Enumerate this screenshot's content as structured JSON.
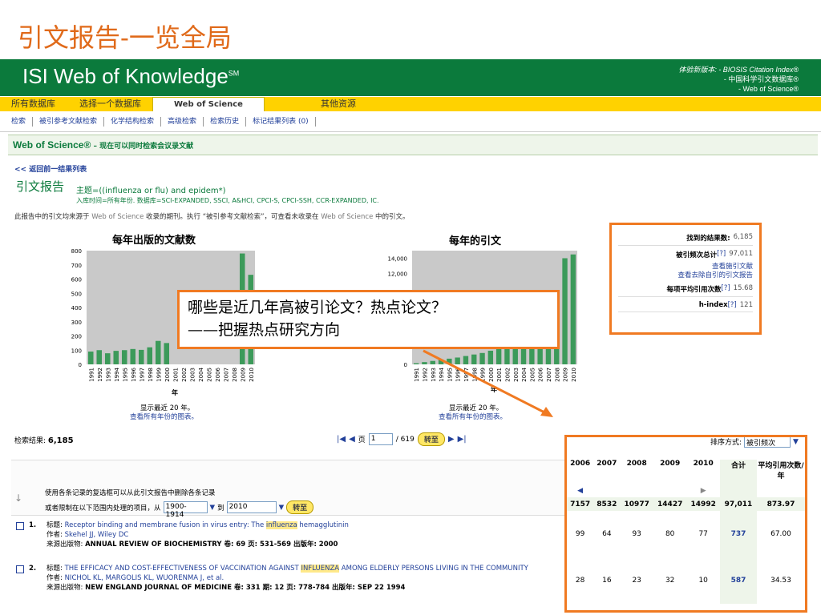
{
  "slide_title": "引文报告-一览全局",
  "banner": {
    "brand": "ISI Web of Knowledge",
    "brand_mark": "SM",
    "editions": [
      "体验新版本: - BIOSIS Citation Index®",
      "- 中国科学引文数据库®",
      "- Web of Science®"
    ]
  },
  "tabs": [
    "所有数据库",
    "选择一个数据库",
    "Web of Science",
    "其他资源"
  ],
  "subnav": [
    "检索",
    "被引参考文献检索",
    "化学结构检索",
    "高级检索",
    "检索历史",
    "标记结果列表 (0)"
  ],
  "wos_header": {
    "title": "Web of Science®",
    "subtitle": "– 现在可以同时检索会议录文献"
  },
  "back_link": "<< 返回前一结果列表",
  "report": {
    "title": "引文报告",
    "query": "主题=((influenza or flu) and epidem*)",
    "meta": "入库时间=所有年份. 数据库=SCI-EXPANDED, SSCI, A&HCI, CPCI-S, CPCI-SSH, CCR-EXPANDED, IC.",
    "note_a": "此报告中的引文均来源于",
    "note_b": "Web of Science",
    "note_c": "收录的期刊。执行 “被引参考文献检索”，可查看未收录在",
    "note_d": "Web of Science",
    "note_e": "中的引文。"
  },
  "chart_data": [
    {
      "type": "bar",
      "title": "每年出版的文献数",
      "xlabel": "年",
      "ylabel": "",
      "ylim": [
        0,
        800
      ],
      "yticks": [
        "800",
        "700",
        "600",
        "500",
        "400",
        "300",
        "200",
        "100",
        "0"
      ],
      "categories": [
        "1991",
        "1992",
        "1993",
        "1994",
        "1995",
        "1996",
        "1997",
        "1998",
        "1999",
        "2000",
        "2001",
        "2002",
        "2003",
        "2004",
        "2005",
        "2006",
        "2007",
        "2008",
        "2009",
        "2010"
      ],
      "values": [
        90,
        100,
        78,
        95,
        100,
        108,
        102,
        120,
        165,
        150,
        0,
        0,
        0,
        0,
        0,
        0,
        0,
        0,
        780,
        630
      ],
      "footer": "显示最近 20 年。",
      "link": "查看所有年份的图表。"
    },
    {
      "type": "bar",
      "title": "每年的引文",
      "xlabel": "年",
      "ylabel": "",
      "ylim": [
        0,
        15000
      ],
      "yticks": [
        "14,000",
        "12,000",
        "0"
      ],
      "categories": [
        "1991",
        "1992",
        "1993",
        "1994",
        "1995",
        "1996",
        "1997",
        "1998",
        "1999",
        "2000",
        "2001",
        "2002",
        "2003",
        "2004",
        "2005",
        "2006",
        "2007",
        "2008",
        "2009",
        "2010"
      ],
      "values": [
        150,
        300,
        450,
        600,
        750,
        900,
        1100,
        1300,
        1500,
        1800,
        2200,
        2600,
        3000,
        3400,
        3900,
        4400,
        5000,
        8000,
        14000,
        14500
      ],
      "footer": "显示最近 20 年。",
      "link": "查看所有年份的图表。"
    }
  ],
  "stats": {
    "results_label": "找到的结果数:",
    "results_value": "6,185",
    "cites_label": "被引频次总计",
    "help": "[?]",
    "cites_value": "97,011",
    "link1": "查看施引文献",
    "link2": "查看去除自引的引文报告",
    "avg_label": "每项平均引用次数",
    "avg_value": "15.68",
    "h_label": "h-index",
    "h_value": "121"
  },
  "callout": {
    "line1": "哪些是近几年高被引论文？热点论文？",
    "line2": "——把握热点研究方向"
  },
  "results": {
    "label": "检索结果:",
    "count": "6,185",
    "page_label": "页",
    "page_value": "1",
    "page_total": "/ 619",
    "go": "转至",
    "sort_label": "排序方式:",
    "sort_value": "被引频次"
  },
  "filter": {
    "line1": "使用各条记录的复选框可以从此引文报告中删除各条记录",
    "line2": "或者限制在以下范围内处理的项目，从",
    "from": "1900-1914",
    "to_label": "到",
    "to": "2010",
    "go": "转至"
  },
  "years": {
    "headers": [
      "2006",
      "2007",
      "2008",
      "2009",
      "2010",
      "合计",
      "平均引用次数/年"
    ],
    "totals": [
      "7157",
      "8532",
      "10977",
      "14427",
      "14992",
      "97,011",
      "873.97"
    ]
  },
  "records": [
    {
      "num": "1.",
      "title_label": "标题:",
      "title_a": "Receptor binding and membrane fusion in virus entry: The ",
      "title_hl": "influenza",
      "title_b": " hemagglutinin",
      "author_label": "作者:",
      "authors": "Skehel JJ, Wiley DC",
      "source_label": "来源出版物:",
      "source": "ANNUAL REVIEW OF BIOCHEMISTRY  卷: 69  页: 531-569  出版年: 2000",
      "cites": [
        "99",
        "64",
        "93",
        "80",
        "77"
      ],
      "total": "737",
      "avg": "67.00"
    },
    {
      "num": "2.",
      "title_label": "标题:",
      "title_a": "THE EFFICACY AND COST-EFFECTIVENESS OF VACCINATION AGAINST ",
      "title_hl": "INFLUENZA",
      "title_b": " AMONG ELDERLY PERSONS LIVING IN THE COMMUNITY",
      "author_label": "作者:",
      "authors": "NICHOL KL, MARGOLIS KL, WUORENMA J, et al.",
      "source_label": "来源出版物:",
      "source": "NEW ENGLAND JOURNAL OF MEDICINE  卷: 331  期: 12  页: 778-784  出版年: SEP 22 1994",
      "cites": [
        "28",
        "16",
        "23",
        "32",
        "10"
      ],
      "total": "587",
      "avg": "34.53"
    }
  ],
  "colors": {
    "accent": "#f07a22",
    "banner": "#0b7a3c",
    "tab": "#ffd200",
    "bar": "#3c9a5a",
    "link": "#23419a"
  }
}
